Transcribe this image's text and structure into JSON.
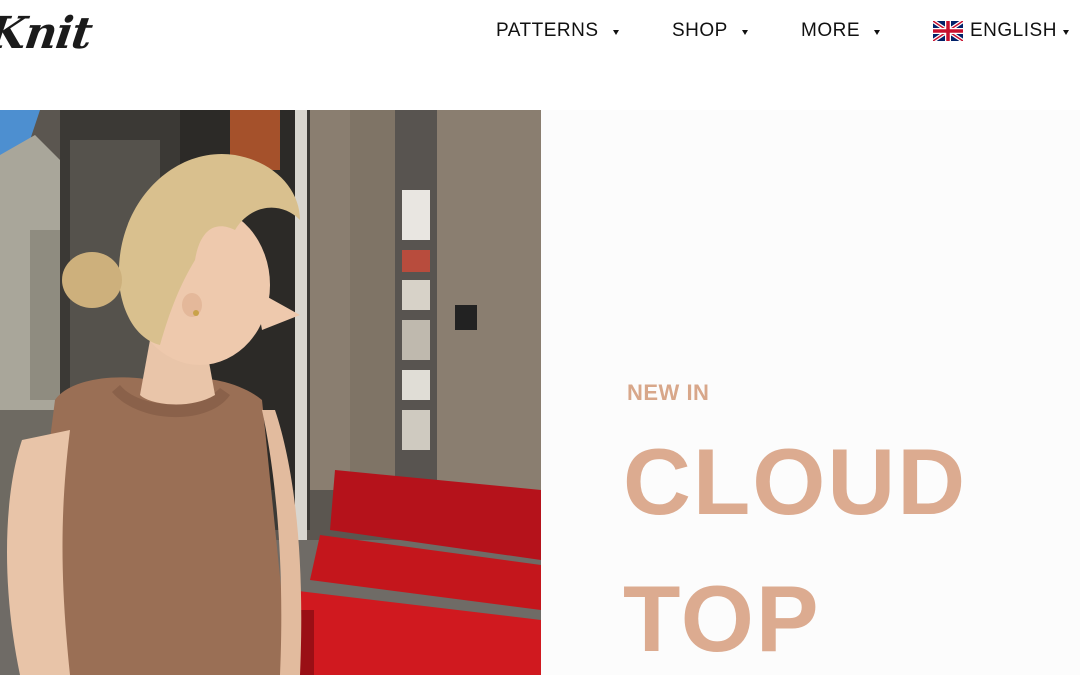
{
  "brand": {
    "logo_text": "Knit"
  },
  "nav": {
    "items": [
      {
        "label": "PATTERNS",
        "icon": "caret-down-icon"
      },
      {
        "label": "SHOP",
        "icon": "caret-down-icon"
      },
      {
        "label": "MORE",
        "icon": "caret-down-icon"
      }
    ],
    "language": {
      "label": "ENGLISH",
      "icon": "uk-flag-icon"
    }
  },
  "hero": {
    "image_alt": "Woman wearing a brown knitted sleeveless top standing by a red bench",
    "eyebrow": "NEW IN",
    "title_lines": [
      "CLOUD",
      "TOP"
    ]
  },
  "colors": {
    "accent": "#dcab90",
    "text": "#111111",
    "panel_bg": "#fcfcfc",
    "sweater": "#9a6f55",
    "bench": "#c4161c"
  }
}
